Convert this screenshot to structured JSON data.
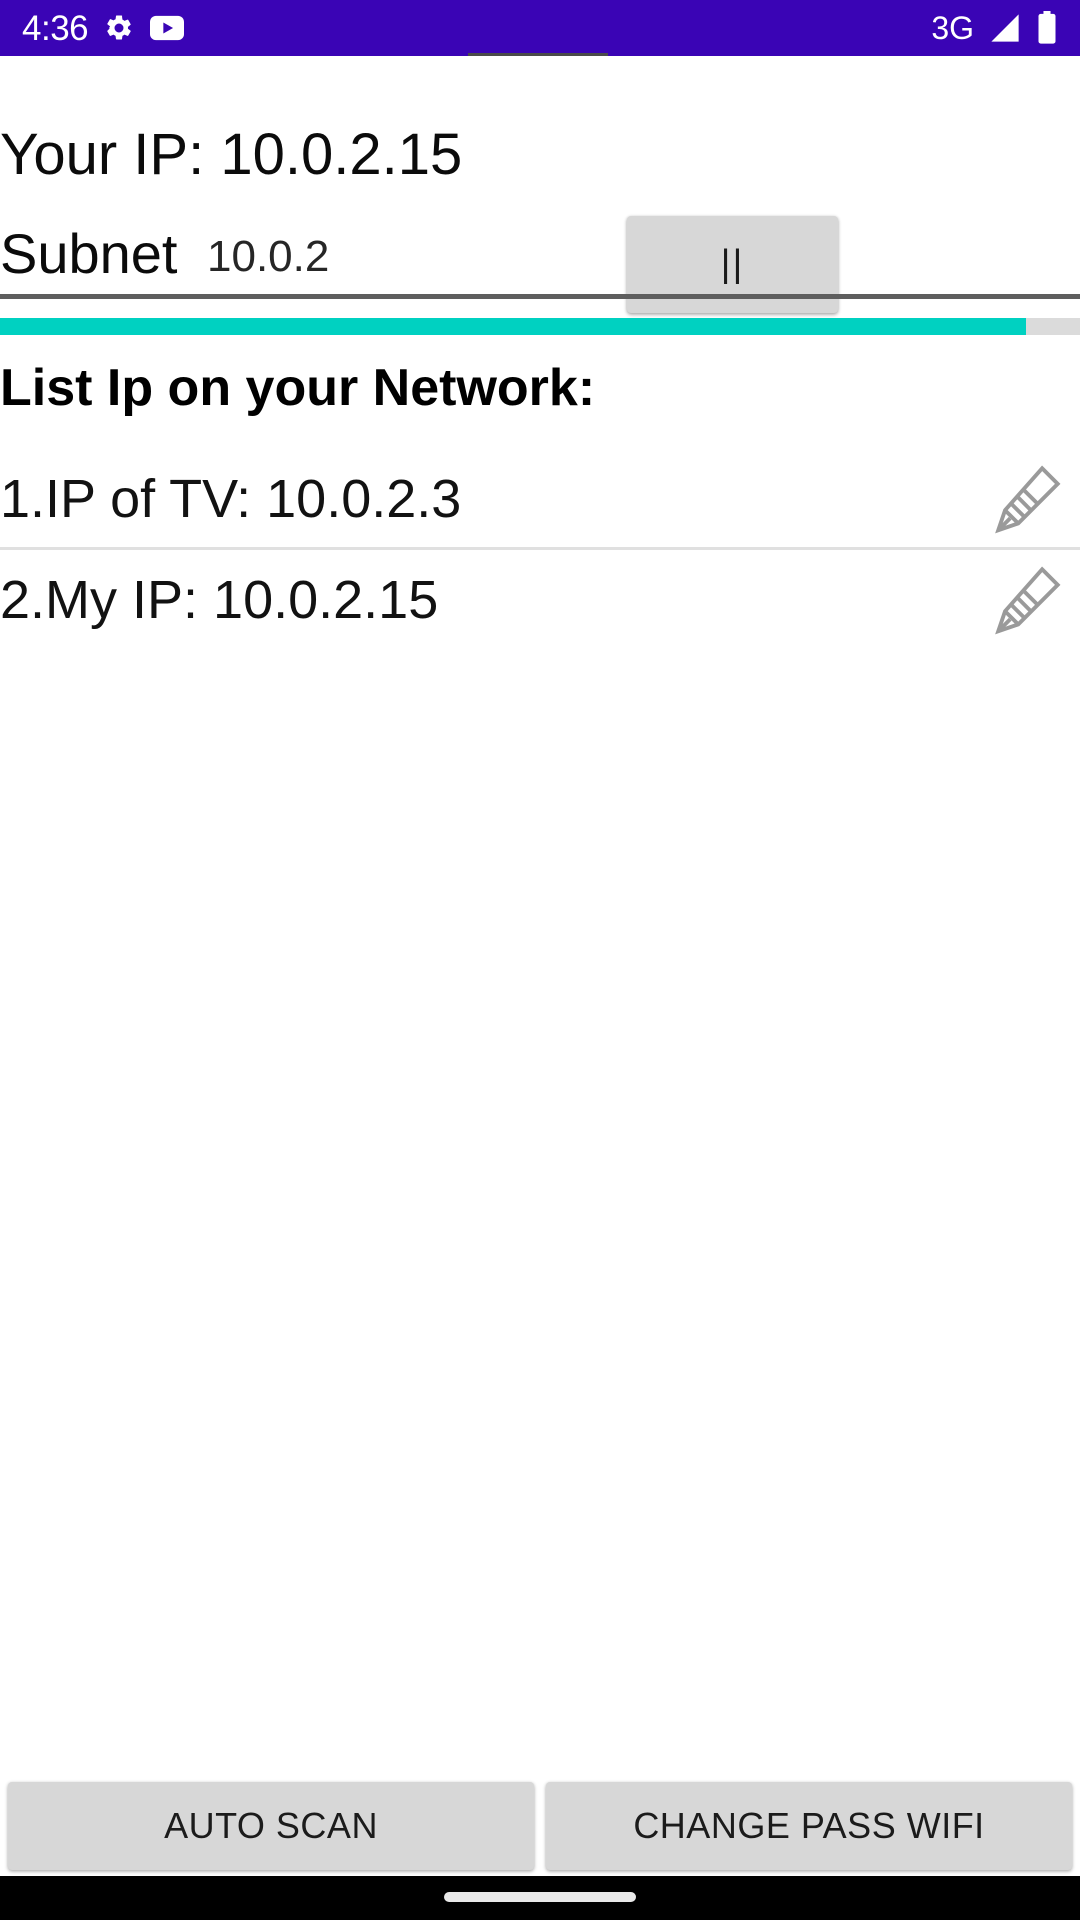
{
  "status_bar": {
    "clock": "4:36",
    "network_type": "3G",
    "background_color": "#3a04b5",
    "icons": [
      "gear-icon",
      "youtube-icon",
      "signal-icon",
      "battery-icon"
    ]
  },
  "header": {
    "your_ip_label": "Your IP: 10.0.2.15",
    "subnet_label": "Subnet",
    "subnet_value": "10.0.2",
    "subnet_placeholder": "10.0.2",
    "pause_button_label": "||"
  },
  "progress": {
    "percent": 95,
    "fill_color": "#00d1c1",
    "track_color": "#dbdbdb"
  },
  "list": {
    "heading": "List Ip on your Network:",
    "items": [
      {
        "text": "1.IP of TV: 10.0.2.3",
        "edit_icon": "pencil-icon"
      },
      {
        "text": "2.My IP: 10.0.2.15",
        "edit_icon": "pencil-icon"
      }
    ]
  },
  "bottom_actions": {
    "auto_scan_label": "AUTO SCAN",
    "change_pass_wifi_label": "CHANGE PASS WIFI"
  }
}
